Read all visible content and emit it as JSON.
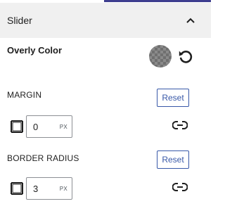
{
  "panel": {
    "title": "Slider",
    "toggle_icon": "chevron-up-icon"
  },
  "overlay": {
    "label": "Overly Color",
    "swatch_icon": "transparent-checker-swatch",
    "reset_icon": "reset-arrow-icon"
  },
  "margin": {
    "label": "MARGIN",
    "reset_label": "Reset",
    "value": "0",
    "unit": "PX",
    "side_icon": "box-sides-icon",
    "link_icon": "link-icon"
  },
  "border_radius": {
    "label": "BORDER RADIUS",
    "reset_label": "Reset",
    "value": "3",
    "unit": "PX",
    "side_icon": "box-sides-icon",
    "link_icon": "link-icon"
  },
  "colors": {
    "accent": "#3858a8",
    "header_bg": "#f0f0f0",
    "top_accent": "#3e3e8f"
  }
}
